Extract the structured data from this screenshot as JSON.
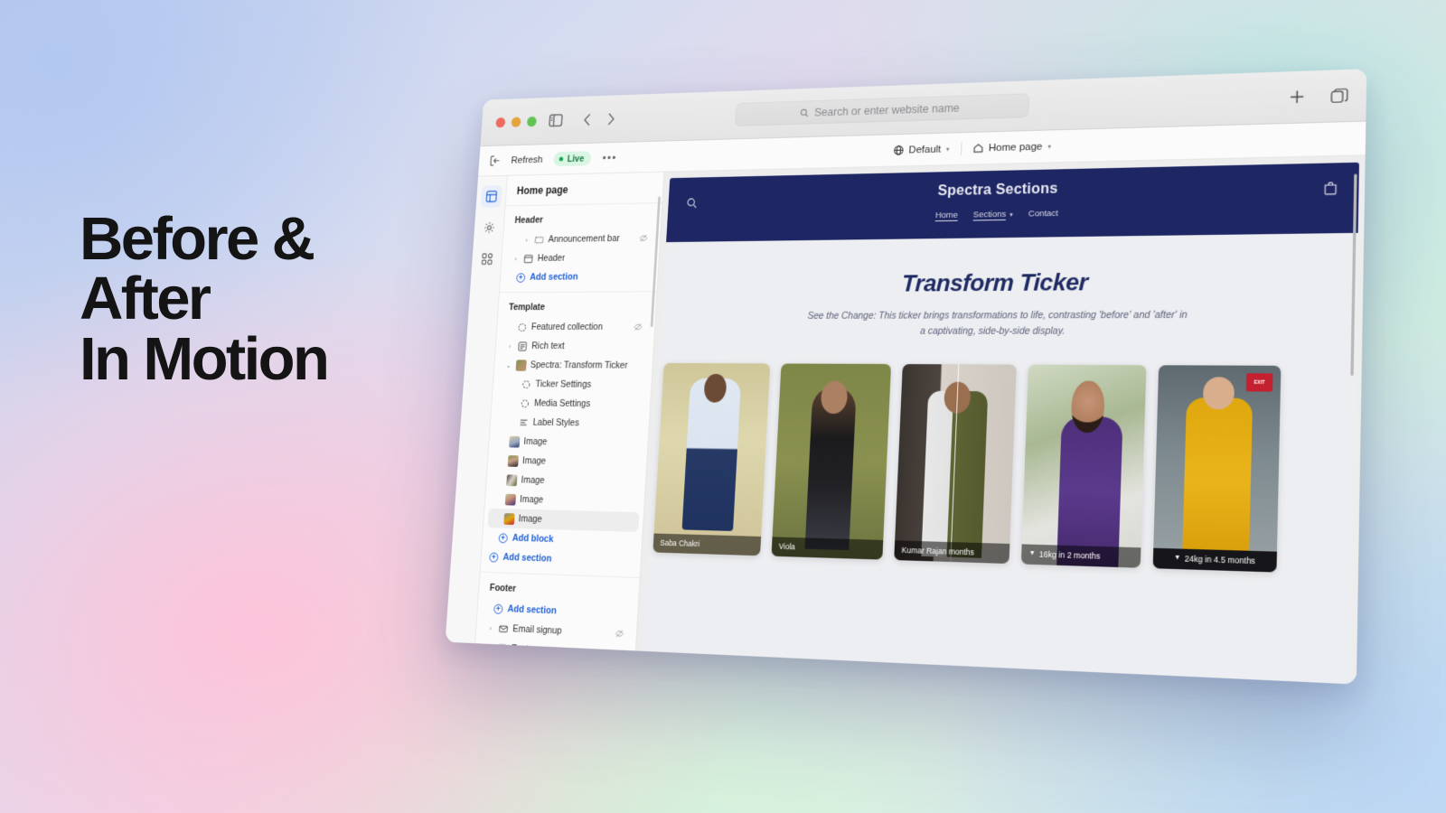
{
  "poster": {
    "headline": "Before &\nAfter\nIn Motion",
    "colors": {
      "headline": "#141414",
      "accent_navy": "#1e2663",
      "link_blue": "#1f5fd6",
      "live_green": "#19a355"
    }
  },
  "browser": {
    "traffic_lights": [
      "close",
      "minimize",
      "zoom"
    ],
    "sidebar_toggle_icon": "sidebar-icon",
    "back_icon": "chevron-left-icon",
    "forward_icon": "chevron-right-icon",
    "address_bar": {
      "placeholder": "Search or enter website name",
      "value": "",
      "icon": "search-icon"
    },
    "new_tab_icon": "plus-icon",
    "tab_overview_icon": "tabs-icon"
  },
  "editor_bar": {
    "exit_icon": "exit-icon",
    "refresh_label": "Refresh",
    "live_label": "Live",
    "more_label": "•••",
    "theme_selector": {
      "icon": "globe-icon",
      "label": "Default",
      "caret": "▾"
    },
    "page_selector": {
      "icon": "home-icon",
      "label": "Home page",
      "caret": "▾"
    }
  },
  "rail": {
    "items": [
      {
        "name": "sections",
        "icon": "sections-icon",
        "active": true
      },
      {
        "name": "settings",
        "icon": "gear-icon",
        "active": false
      },
      {
        "name": "apps",
        "icon": "apps-icon",
        "active": false
      }
    ]
  },
  "sidebar": {
    "title": "Home page",
    "groups": [
      {
        "heading": "Header",
        "rows": [
          {
            "label": "Announcement bar",
            "icon": "announcement-icon",
            "chevron": "›",
            "indent": 1,
            "eye": true
          },
          {
            "label": "Header",
            "icon": "header-icon",
            "chevron": "›",
            "indent": 0,
            "eye": false
          }
        ],
        "add_label": "Add section"
      },
      {
        "heading": "Template",
        "rows": [
          {
            "label": "Featured collection",
            "icon": "collection-icon",
            "chevron": "",
            "indent": 1,
            "eye": true
          },
          {
            "label": "Rich text",
            "icon": "richtext-icon",
            "chevron": "›",
            "indent": 0,
            "eye": false
          },
          {
            "label": "Spectra: Transform Ticker",
            "icon": "app-block-icon",
            "chevron": "⌄",
            "indent": 0,
            "eye": false
          },
          {
            "label": "Ticker Settings",
            "icon": "settings-block-icon",
            "chevron": "",
            "indent": 2,
            "eye": false
          },
          {
            "label": "Media Settings",
            "icon": "media-settings-icon",
            "chevron": "",
            "indent": 2,
            "eye": false
          },
          {
            "label": "Label Styles",
            "icon": "label-styles-icon",
            "chevron": "",
            "indent": 2,
            "eye": false
          },
          {
            "label": "Image",
            "icon": "image-thumb-1",
            "chevron": "",
            "indent": 1,
            "eye": false
          },
          {
            "label": "Image",
            "icon": "image-thumb-2",
            "chevron": "",
            "indent": 1,
            "eye": false
          },
          {
            "label": "Image",
            "icon": "image-thumb-3",
            "chevron": "",
            "indent": 1,
            "eye": false
          },
          {
            "label": "Image",
            "icon": "image-thumb-4",
            "chevron": "",
            "indent": 1,
            "eye": false
          },
          {
            "label": "Image",
            "icon": "image-thumb-5",
            "chevron": "",
            "indent": 1,
            "eye": false,
            "selected": true
          }
        ],
        "add_block_label": "Add block",
        "add_label": "Add section"
      },
      {
        "heading": "Footer",
        "add_label": "Add section",
        "rows": [
          {
            "label": "Email signup",
            "icon": "email-icon",
            "chevron": "›",
            "indent": 0,
            "eye": true
          },
          {
            "label": "Footer",
            "icon": "footer-icon",
            "chevron": "›",
            "indent": 0,
            "eye": false
          }
        ]
      }
    ]
  },
  "store": {
    "header": {
      "title": "Spectra Sections",
      "search_icon": "search-icon",
      "cart_icon": "cart-icon",
      "nav": [
        {
          "label": "Home",
          "underlined": true,
          "caret": false
        },
        {
          "label": "Sections",
          "underlined": true,
          "caret": true
        },
        {
          "label": "Contact",
          "underlined": false,
          "caret": false
        }
      ]
    },
    "section": {
      "heading": "Transform Ticker",
      "subheading": "See the Change: This ticker brings transformations to life, contrasting 'before' and 'after' in a captivating, side-by-side display."
    },
    "cards": [
      {
        "label": "Saba Chakri",
        "style": "ph1",
        "label_style": "plain"
      },
      {
        "label": "Viola",
        "style": "ph2",
        "label_style": "plain"
      },
      {
        "label": "Kumar Rajan months",
        "style": "ph3",
        "label_style": "plain",
        "split": true
      },
      {
        "label": "16kg in 2 months",
        "style": "ph4",
        "label_style": "plain",
        "caret": "▼"
      },
      {
        "label": "24kg in 4.5 months",
        "style": "ph5",
        "label_style": "dark",
        "caret": "▼"
      }
    ]
  }
}
